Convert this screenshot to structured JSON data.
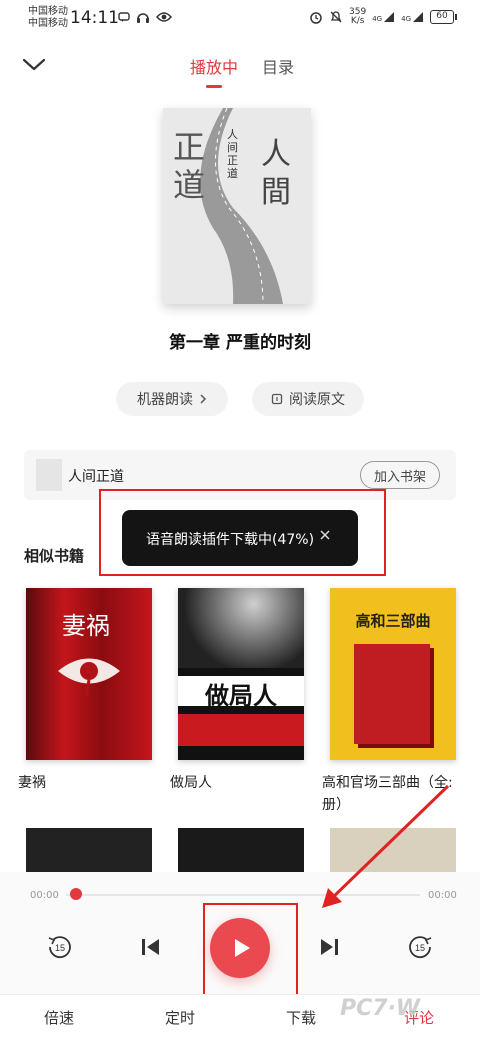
{
  "status_bar": {
    "carrier_1": "中国移动",
    "carrier_2": "中国移动",
    "time": "14:11",
    "net_speed_value": "359",
    "net_speed_unit": "K/s",
    "signal_1": "4G",
    "signal_2": "4G",
    "battery": "60"
  },
  "header": {
    "tabs": [
      {
        "label": "播放中",
        "active": true
      },
      {
        "label": "目录",
        "active": false
      }
    ]
  },
  "cover": {
    "text_left": "正道",
    "text_right": "人間",
    "text_center": "人间正道"
  },
  "chapter_title": "第一章 严重的时刻",
  "actions": {
    "machine_read": "机器朗读",
    "read_original": "阅读原文"
  },
  "book_bar": {
    "name": "人间正道",
    "add_shelf": "加入书架"
  },
  "toast": {
    "message": "语音朗读插件下载中(47%)",
    "progress_percent": 47
  },
  "similar": {
    "title": "相似书籍",
    "books": [
      {
        "title": "妻祸",
        "cover_text": "妻祸"
      },
      {
        "title": "做局人",
        "cover_text": "做局人"
      },
      {
        "title": "高和官场三部曲（全:\n册）",
        "cover_text": "高和三部曲"
      }
    ]
  },
  "player": {
    "time_current": "00:00",
    "time_total": "00:00",
    "progress": 0,
    "back_seconds": "15",
    "forward_seconds": "15"
  },
  "bottom_nav": {
    "speed": "倍速",
    "timer": "定时",
    "download": "下载",
    "more": "评论"
  },
  "colors": {
    "accent": "#e0393e",
    "annotation": "#e02222"
  },
  "icons": [
    "chevron-down-icon",
    "chevron-right-icon",
    "book-icon",
    "close-icon",
    "rewind-15-icon",
    "previous-icon",
    "play-icon",
    "next-icon",
    "forward-15-icon"
  ]
}
